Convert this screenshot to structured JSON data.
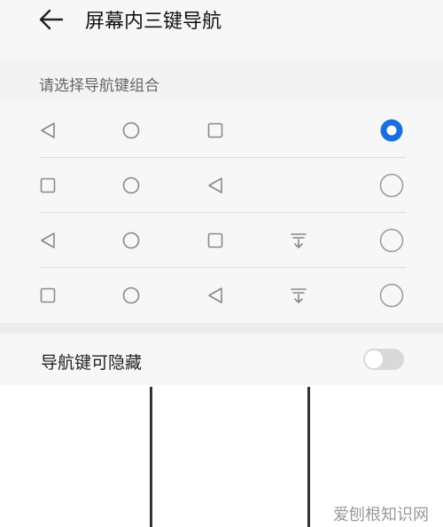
{
  "header": {
    "title": "屏幕内三键导航",
    "back_icon": "arrow-left-icon"
  },
  "section": {
    "label": "请选择导航键组合"
  },
  "combinations": [
    {
      "keys": [
        "back",
        "home",
        "recent"
      ],
      "selected": true
    },
    {
      "keys": [
        "recent",
        "home",
        "back"
      ],
      "selected": false
    },
    {
      "keys": [
        "back",
        "home",
        "recent",
        "notification"
      ],
      "selected": false
    },
    {
      "keys": [
        "recent",
        "home",
        "back",
        "notification"
      ],
      "selected": false
    }
  ],
  "hide_toggle": {
    "label": "导航键可隐藏",
    "on": false
  },
  "watermark": "爱刨根知识网",
  "colors": {
    "accent": "#1a6fe0",
    "icon": "#888888",
    "radio_off": "#999999",
    "switch_off": "#d9d9d9"
  }
}
